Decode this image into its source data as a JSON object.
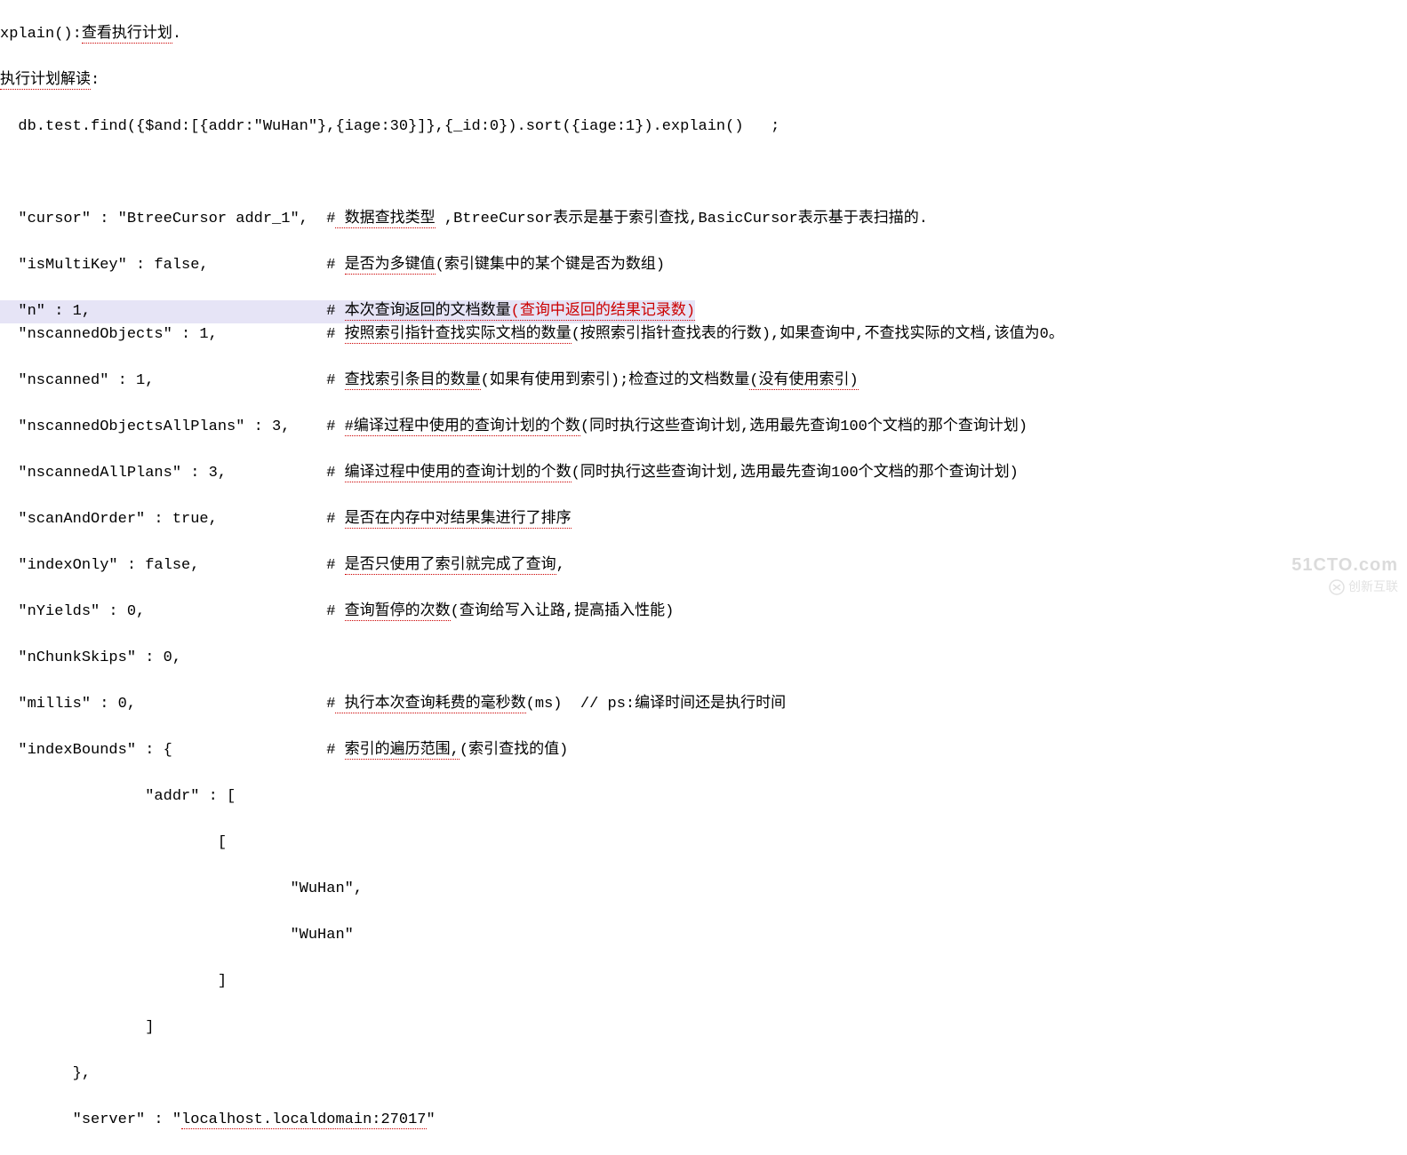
{
  "lines": {
    "l1a": "xplain():",
    "l1b": "查看执行计划",
    "l1c": ".",
    "l2a": "执行计划解读",
    "l2b": ":",
    "l3": "  db.test.find({$and:[{addr:\"WuHan\"},{iage:30}]},{_id:0}).sort({iage:1}).explain()   ;",
    "l5a": "  \"cursor\" : \"BtreeCursor addr_1\",  #",
    "l5b": " 数据查找类型",
    "l5c": " ,BtreeCursor表示是基于索引查找,BasicCursor表示基于表扫描的.",
    "l6a": "  \"isMultiKey\" : false,             # ",
    "l6b": "是否为多键值",
    "l6c": "(索引键集中的某个键是否为数组)",
    "l7a": "  \"n\" : 1,                          # ",
    "l7b": "本次查询返回的文档数量",
    "l7c": "(查询中返回的结果记录数)",
    "l8a": "  \"nscannedObjects\" : 1,            # ",
    "l8b": "按照索引指针查找实际文档的数量",
    "l8c": "(按照索引指针查找表的行数),如果查询中,不查找实际的文档,该值为0。",
    "l9a": "  \"nscanned\" : 1,                   # ",
    "l9b": "查找索引条目的数量",
    "l9c": "(如果有使用到索引);检查过的文档数量",
    "l9d": "(没有使用索引)",
    "l10a": "  \"nscannedObjectsAllPlans\" : 3,    # ",
    "l10b": "#编译过程中使用的查询计划的个数",
    "l10c": "(同时执行这些查询计划,选用最先查询100个文档的那个查询计划)",
    "l11a": "  \"nscannedAllPlans\" : 3,           # ",
    "l11b": "编译过程中使用的查询计划的个数",
    "l11c": "(同时执行这些查询计划,选用最先查询100个文档的那个查询计划)",
    "l12a": "  \"scanAndOrder\" : true,            # ",
    "l12b": "是否在内存中对结果集进行了排序",
    "l13a": "  \"indexOnly\" : false,              # ",
    "l13b": "是否只使用了索引就完成了查询",
    "l13c": ",",
    "l14a": "  \"nYields\" : 0,                    # ",
    "l14b": "查询暂停的次数",
    "l14c": "(查询给写入让路,提高插入性能)",
    "l15": "  \"nChunkSkips\" : 0,",
    "l16a": "  \"millis\" : 0,                     #",
    "l16b": " 执行本次查询耗费的毫秒数",
    "l16c": "(ms)  // ps:编译时间还是执行时间",
    "l17a": "  \"indexBounds\" : {                 # ",
    "l17b": "索引的遍历范围,",
    "l17c": "(索引查找的值)",
    "l18": "                \"addr\" : [",
    "l19": "                        [",
    "l20": "                                \"WuHan\",",
    "l21": "                                \"WuHan\"",
    "l22": "                        ]",
    "l23": "                ]",
    "l24": "        },",
    "l25a": "        \"server\" : \"",
    "l25b": "localhost.localdomain:27017",
    "l25c": "\""
  },
  "watermark": {
    "top": "51CTO.com",
    "bottom": "创新互联"
  }
}
